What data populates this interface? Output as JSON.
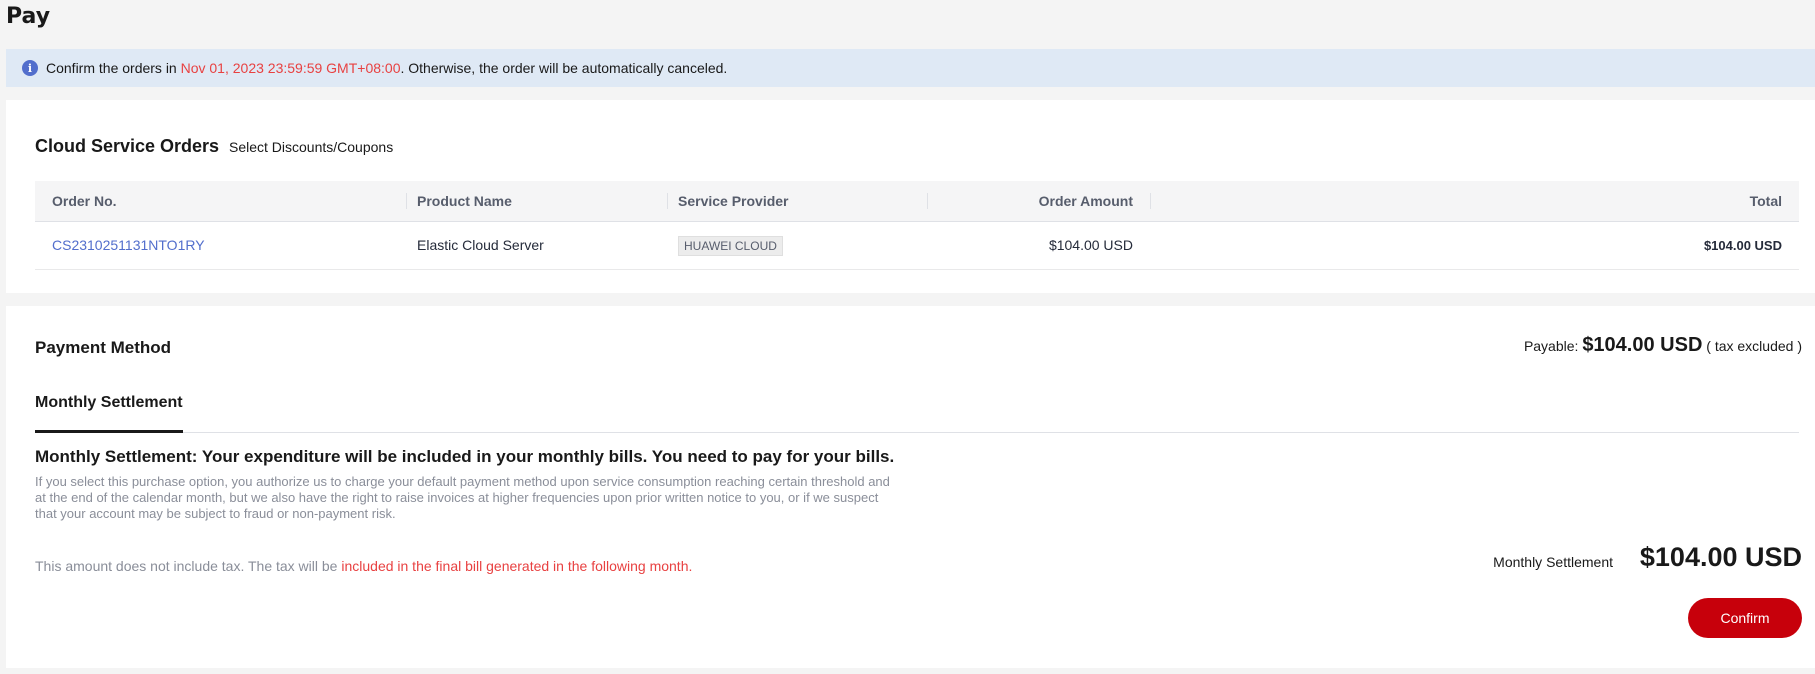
{
  "page": {
    "title": "Pay"
  },
  "notice": {
    "icon": "info-icon",
    "prefix": "Confirm the orders in ",
    "deadline": "Nov 01, 2023 23:59:59 GMT+08:00",
    "suffix": ". Otherwise, the order will be automatically canceled."
  },
  "orders": {
    "title": "Cloud Service Orders",
    "discount_link": "Select Discounts/Coupons",
    "columns": [
      "Order No.",
      "Product Name",
      "Service Provider",
      "Order Amount",
      "Total"
    ],
    "rows": [
      {
        "order_no": "CS2310251131NTO1RY",
        "product": "Elastic Cloud Server",
        "provider": "HUAWEI CLOUD",
        "amount": "$104.00 USD",
        "total": "$104.00 USD"
      }
    ]
  },
  "payment": {
    "title": "Payment Method",
    "payable_label": "Payable:",
    "payable_amount": "$104.00 USD",
    "payable_note": "( tax excluded )",
    "tabs": [
      "Monthly Settlement"
    ],
    "method_heading": "Monthly Settlement: Your expenditure will be included in your monthly bills. You need to pay for your bills.",
    "method_description": "If you select this purchase option, you authorize us to charge your default payment method upon service consumption reaching certain threshold and at the end of the calendar month, but we also have the right to raise invoices at higher frequencies upon prior written notice to you, or if we suspect that your account may be subject to fraud or non-payment risk.",
    "tax_note_prefix": "This amount does not include tax. The tax will be ",
    "tax_note_highlight": "included in the final bill generated in the following month.",
    "summary_label": "Monthly Settlement",
    "summary_amount": "$104.00 USD",
    "confirm_label": "Confirm"
  },
  "colors": {
    "accent": "#c7000b",
    "link": "#526ecc",
    "warning_text": "#e84141",
    "notice_bg": "#dfe9f5"
  }
}
